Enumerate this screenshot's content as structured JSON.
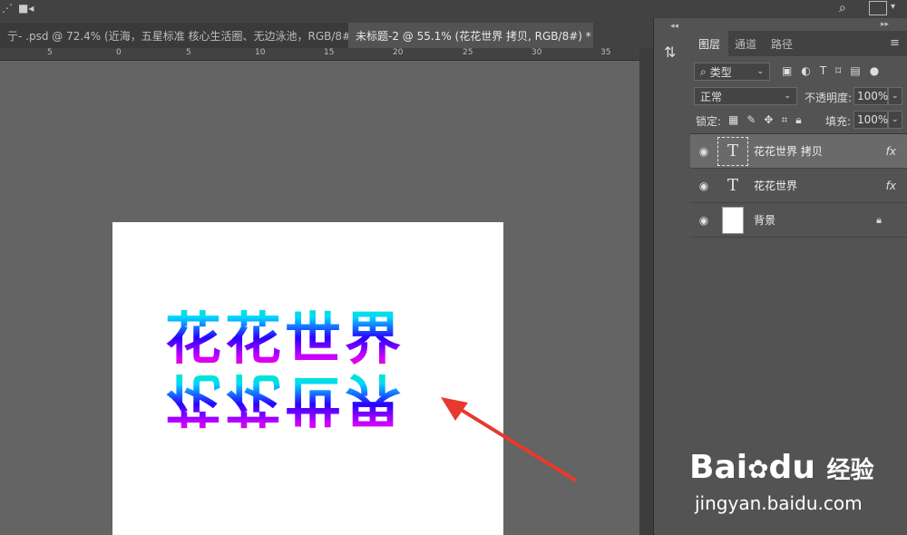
{
  "tabs": [
    {
      "label": "亍- .psd @ 72.4% (近海，五星标准 核心生活圈、无边泳池，RGB/8#)",
      "close": "×"
    },
    {
      "label": "未标题-2 @ 55.1% (花花世界 拷贝, RGB/8#) *",
      "close": "×"
    }
  ],
  "ruler": [
    "5",
    "0",
    "5",
    "10",
    "15",
    "20",
    "25",
    "30",
    "35"
  ],
  "canvas": {
    "text_upper": "花花世界",
    "text_lower": "花花世界"
  },
  "panel": {
    "tabs": [
      "图层",
      "通道",
      "路径"
    ],
    "filter_label": "类型",
    "blend_mode": "正常",
    "opacity_label": "不透明度:",
    "opacity_value": "100%",
    "lock_label": "锁定:",
    "fill_label": "填充:",
    "fill_value": "100%"
  },
  "layers": [
    {
      "name": "花花世界 拷贝",
      "thumb": "T",
      "fx": "fx"
    },
    {
      "name": "花花世界",
      "thumb": "T",
      "fx": "fx"
    },
    {
      "name": "背景"
    }
  ],
  "watermark": {
    "brand": "Bai",
    "brand2": "du",
    "suffix": "经验",
    "url": "jingyan.baidu.com"
  },
  "colors": {
    "arrow": "#e8392e",
    "selected_layer": "#6a6a6a"
  }
}
